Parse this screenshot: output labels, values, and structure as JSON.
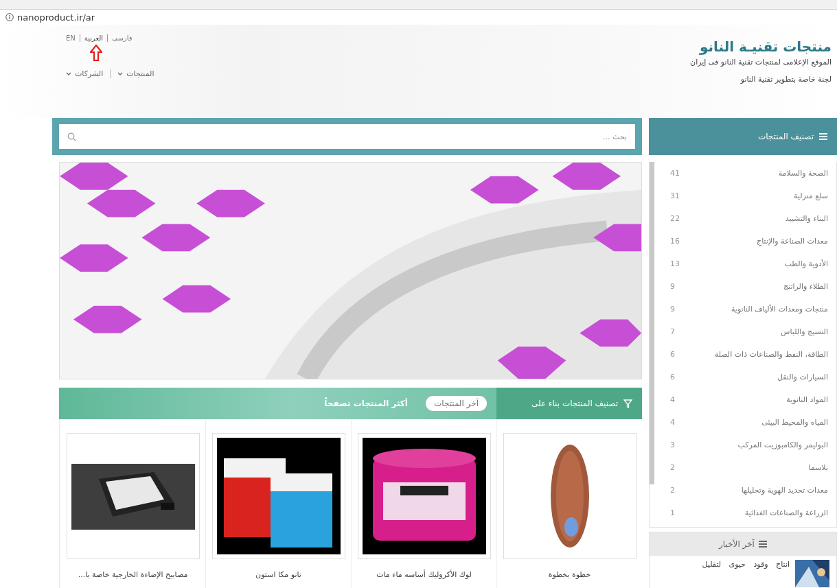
{
  "address_bar": {
    "url": "nanoproduct.ir/ar"
  },
  "header": {
    "title": "منتجات تقنيـة النانو",
    "subtitle": "الموقع الإعلامی لمنتجات تقنية النانو فی إيران",
    "tagline": "لجنة خاصة بتطوير تقنية النانو"
  },
  "languages": [
    {
      "label": "فارسی",
      "selected": false
    },
    {
      "label": "العربية",
      "selected": true
    },
    {
      "label": "EN",
      "selected": false
    }
  ],
  "nav": [
    {
      "label": "المنتجات"
    },
    {
      "label": "الشركات"
    }
  ],
  "categories_title": "تصنيف المنتجات",
  "search": {
    "placeholder": "بحث ..."
  },
  "categories": [
    {
      "name": "الصحة والسلامة",
      "count": "41"
    },
    {
      "name": "سلع منزلية",
      "count": "31"
    },
    {
      "name": "البناء والتشييد",
      "count": "22"
    },
    {
      "name": "معدات الصناعة والإنتاج",
      "count": "16"
    },
    {
      "name": "الأدوية والطب",
      "count": "13"
    },
    {
      "name": "الطلاء والراتنج",
      "count": "9"
    },
    {
      "name": "منتجات ومعدات الألياف النانوية",
      "count": "9"
    },
    {
      "name": "النسيج واللباس",
      "count": "7"
    },
    {
      "name": "الطاقة، النفط والصناعات ذات الصلة",
      "count": "6"
    },
    {
      "name": "السيارات والنقل",
      "count": "6"
    },
    {
      "name": "المواد النانوية",
      "count": "4"
    },
    {
      "name": "المياه والمحيط البيئی",
      "count": "4"
    },
    {
      "name": "البوليمر والكامبوزيت المركب",
      "count": "3"
    },
    {
      "name": "بلاسما",
      "count": "2"
    },
    {
      "name": "معدات تحديد الهوية وتحليلها",
      "count": "2"
    },
    {
      "name": "الزراعة والصناعات الغذائية",
      "count": "1"
    }
  ],
  "products_panel": {
    "title": "تصنيف المنتجات بناء على",
    "tabs": [
      {
        "label": "آخر المنتجات",
        "selected": true
      },
      {
        "label": "أكثر المنتجات تصفحاً",
        "selected": false
      }
    ]
  },
  "products": [
    {
      "title": "خطوة بخطوة"
    },
    {
      "title": "لوك الأكروليك أساسه ماء مات"
    },
    {
      "title": "نانو مكا استون"
    },
    {
      "title": "مصابيح الإضاءة الخارجية خاصة با..."
    }
  ],
  "news": {
    "title": "آخر الأخبار",
    "items": [
      {
        "title": "انتاج وقود حیوی لتقلیل"
      }
    ]
  }
}
